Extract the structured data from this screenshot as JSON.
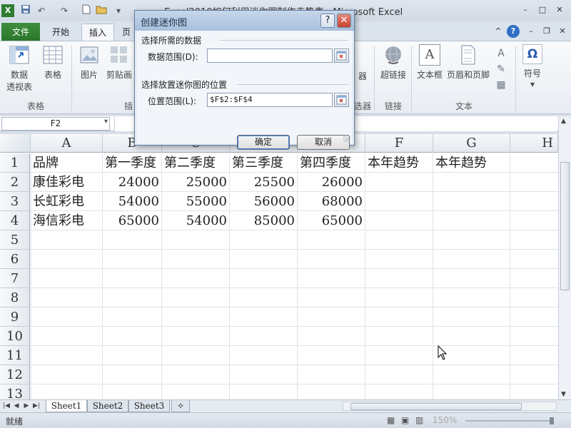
{
  "window": {
    "title": "Excel2010如何利用迷你图制作走势表 - Microsoft Excel",
    "min": "–",
    "max": "□",
    "close": "✕"
  },
  "quick_access": {
    "undo": "↶",
    "redo": "↷"
  },
  "ribbon": {
    "file_tab": "文件",
    "tabs": [
      "开始",
      "插入",
      "页"
    ],
    "right_icons": {
      "help": "?"
    },
    "buttons": {
      "pivot": [
        "数据",
        "透视表"
      ],
      "table": "表格",
      "picture": "图片",
      "clipart": "剪贴画",
      "chart_label": "器",
      "hyperlink": "超链接",
      "textbox": "文本框",
      "header_footer": "页眉和页脚",
      "symbol": "符号",
      "symbol_glyph": "Ω",
      "textbox_glyph": "A"
    },
    "groups": {
      "tables": "表格",
      "illustrations": "插",
      "filters": "选器",
      "links": "链接",
      "text": "文本"
    }
  },
  "formula_bar": {
    "name_box": "F2"
  },
  "sheet": {
    "columns": [
      "A",
      "B",
      "C",
      "D",
      "E",
      "F",
      "G",
      "H"
    ],
    "rows": [
      "1",
      "2",
      "3",
      "4",
      "5",
      "6",
      "7",
      "8",
      "9",
      "10",
      "11",
      "12",
      "13"
    ],
    "headers": [
      "品牌",
      "第一季度",
      "第二季度",
      "第三季度",
      "第四季度",
      "本年趋势",
      "本年趋势"
    ],
    "data": [
      {
        "brand": "康佳彩电",
        "q1": "24000",
        "q2": "25000",
        "q3": "25500",
        "q4": "26000"
      },
      {
        "brand": "长虹彩电",
        "q1": "54000",
        "q2": "55000",
        "q3": "56000",
        "q4": "68000"
      },
      {
        "brand": "海信彩电",
        "q1": "65000",
        "q2": "54000",
        "q3": "85000",
        "q4": "65000"
      }
    ]
  },
  "sheet_tabs": [
    "Sheet1",
    "Sheet2",
    "Sheet3"
  ],
  "status": {
    "ready": "就绪",
    "zoom": "150%"
  },
  "dialog": {
    "title": "创建迷你图",
    "help": "?",
    "close": "✕",
    "section1": "选择所需的数据",
    "data_range_label": "数据范围(D):",
    "data_range_value": "",
    "section2": "选择放置迷你图的位置",
    "location_label": "位置范围(L):",
    "location_value": "$F$2:$F$4",
    "ok": "确定",
    "cancel": "取消"
  }
}
